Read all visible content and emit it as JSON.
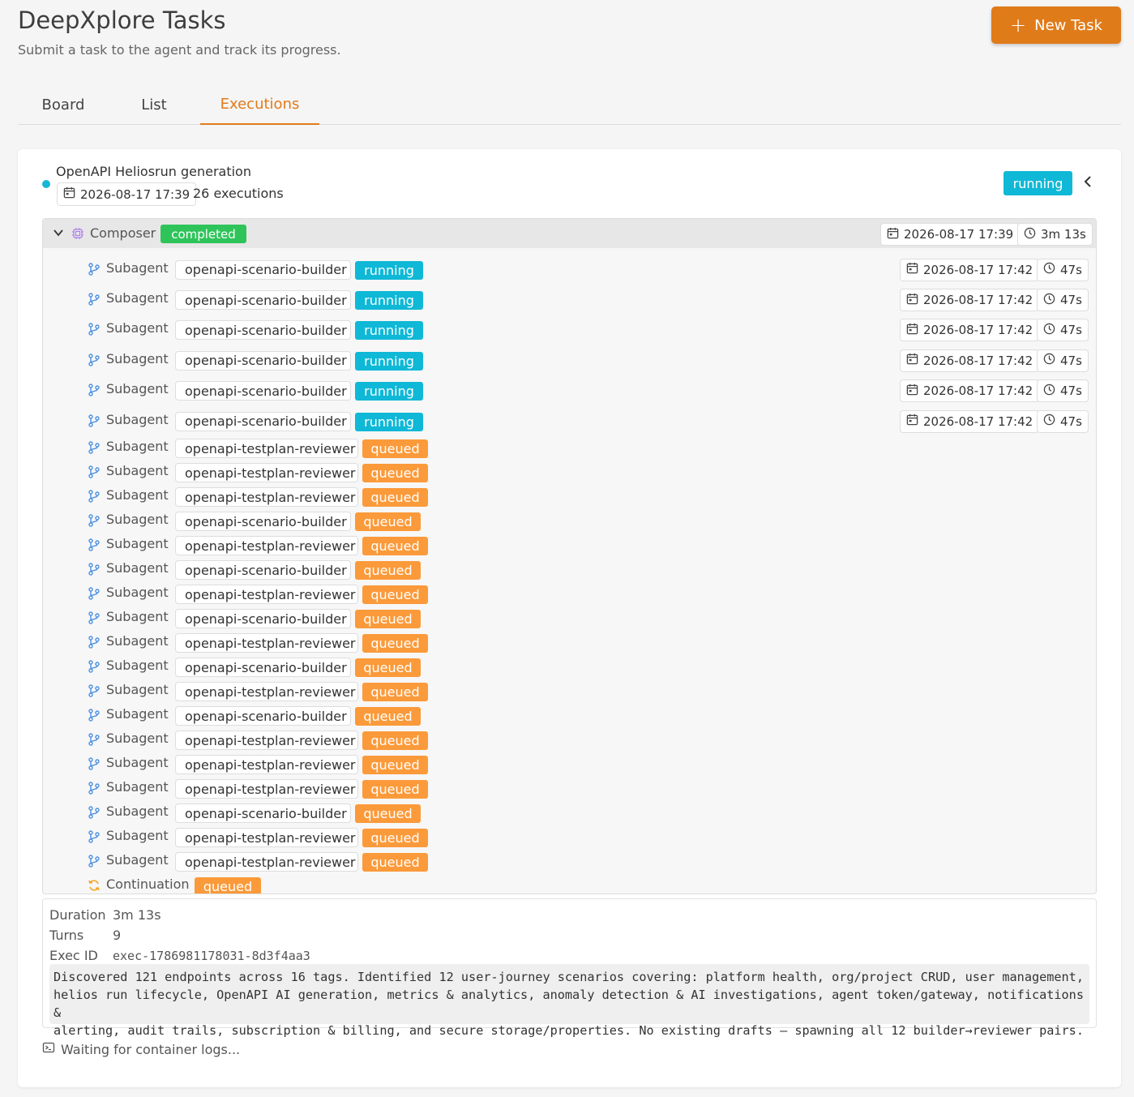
{
  "header": {
    "title": "DeepXplore Tasks",
    "subtitle": "Submit a task to the agent and track its progress.",
    "new_task_label": "New Task"
  },
  "tabs": [
    {
      "label": "Board",
      "active": false
    },
    {
      "label": "List",
      "active": false
    },
    {
      "label": "Executions",
      "active": true
    }
  ],
  "task": {
    "title": "OpenAPI Heliosrun generation",
    "date": "2026-08-17 17:39",
    "executions": "26 executions",
    "status": "running"
  },
  "composer": {
    "label": "Composer",
    "status": "completed",
    "date": "2026-08-17 17:39",
    "duration": "3m 13s"
  },
  "subagents": [
    {
      "label": "Subagent",
      "name": "openapi-scenario-builder",
      "status": "running",
      "date": "2026-08-17 17:42",
      "duration": "47s"
    },
    {
      "label": "Subagent",
      "name": "openapi-scenario-builder",
      "status": "running",
      "date": "2026-08-17 17:42",
      "duration": "47s"
    },
    {
      "label": "Subagent",
      "name": "openapi-scenario-builder",
      "status": "running",
      "date": "2026-08-17 17:42",
      "duration": "47s"
    },
    {
      "label": "Subagent",
      "name": "openapi-scenario-builder",
      "status": "running",
      "date": "2026-08-17 17:42",
      "duration": "47s"
    },
    {
      "label": "Subagent",
      "name": "openapi-scenario-builder",
      "status": "running",
      "date": "2026-08-17 17:42",
      "duration": "47s"
    },
    {
      "label": "Subagent",
      "name": "openapi-scenario-builder",
      "status": "running",
      "date": "2026-08-17 17:42",
      "duration": "47s"
    },
    {
      "label": "Subagent",
      "name": "openapi-testplan-reviewer",
      "status": "queued"
    },
    {
      "label": "Subagent",
      "name": "openapi-testplan-reviewer",
      "status": "queued"
    },
    {
      "label": "Subagent",
      "name": "openapi-testplan-reviewer",
      "status": "queued"
    },
    {
      "label": "Subagent",
      "name": "openapi-scenario-builder",
      "status": "queued"
    },
    {
      "label": "Subagent",
      "name": "openapi-testplan-reviewer",
      "status": "queued"
    },
    {
      "label": "Subagent",
      "name": "openapi-scenario-builder",
      "status": "queued"
    },
    {
      "label": "Subagent",
      "name": "openapi-testplan-reviewer",
      "status": "queued"
    },
    {
      "label": "Subagent",
      "name": "openapi-scenario-builder",
      "status": "queued"
    },
    {
      "label": "Subagent",
      "name": "openapi-testplan-reviewer",
      "status": "queued"
    },
    {
      "label": "Subagent",
      "name": "openapi-scenario-builder",
      "status": "queued"
    },
    {
      "label": "Subagent",
      "name": "openapi-testplan-reviewer",
      "status": "queued"
    },
    {
      "label": "Subagent",
      "name": "openapi-scenario-builder",
      "status": "queued"
    },
    {
      "label": "Subagent",
      "name": "openapi-testplan-reviewer",
      "status": "queued"
    },
    {
      "label": "Subagent",
      "name": "openapi-testplan-reviewer",
      "status": "queued"
    },
    {
      "label": "Subagent",
      "name": "openapi-testplan-reviewer",
      "status": "queued"
    },
    {
      "label": "Subagent",
      "name": "openapi-scenario-builder",
      "status": "queued"
    },
    {
      "label": "Subagent",
      "name": "openapi-testplan-reviewer",
      "status": "queued"
    },
    {
      "label": "Subagent",
      "name": "openapi-testplan-reviewer",
      "status": "queued"
    }
  ],
  "continuation": {
    "label": "Continuation",
    "status": "queued"
  },
  "details": {
    "duration_key": "Duration",
    "duration_val": "3m 13s",
    "turns_key": "Turns",
    "turns_val": "9",
    "exec_id_key": "Exec ID",
    "exec_id_val": "exec-1786981178031-8d3f4aa3",
    "summary_lines": [
      "Discovered 121 endpoints across 16 tags. Identified 12 user-journey scenarios covering: platform health, org/project CRUD, user management,",
      "helios run lifecycle, OpenAPI AI generation, metrics & analytics, anomaly detection & AI investigations, agent token/gateway, notifications &",
      "alerting, audit trails, subscription & billing, and secure storage/properties. No existing drafts — spawning all 12 builder→reviewer pairs."
    ]
  },
  "logs_text": "Waiting for container logs...",
  "colors": {
    "accent": "#e07b1a",
    "running": "#0fb8d6",
    "queued": "#fb9a3a",
    "completed": "#2fc45a",
    "subagent_icon": "#4a90e2"
  }
}
